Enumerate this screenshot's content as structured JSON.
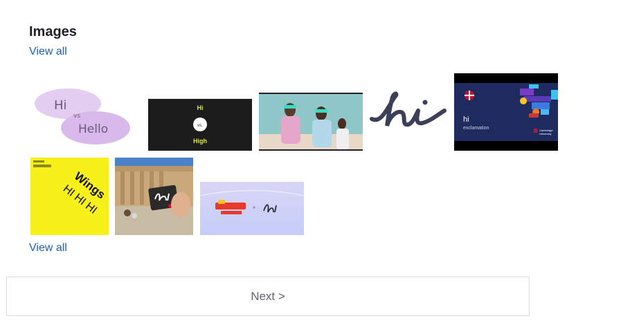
{
  "images_section": {
    "title": "Images",
    "view_all_top": "View all",
    "view_all_bottom": "View all"
  },
  "thumbnails": [
    {
      "name": "hi-vs-hello",
      "text": [
        "Hi",
        "vs",
        "Hello"
      ]
    },
    {
      "name": "hi-vs-high",
      "text": [
        "Hi",
        "vs.",
        "High"
      ]
    },
    {
      "name": "music-video-still",
      "text": []
    },
    {
      "name": "hi-handwritten",
      "text": [
        "hi"
      ]
    },
    {
      "name": "hi-exclamation-cambridge",
      "text": [
        "hi",
        "exclamation",
        "Cambridge",
        "University"
      ]
    },
    {
      "name": "wings-hi-hi-hi",
      "text": [
        "Wings",
        "HI",
        "HI",
        "HI"
      ]
    },
    {
      "name": "acropolis-card",
      "text": []
    },
    {
      "name": "carnival-hi",
      "text": [
        "hi"
      ]
    }
  ],
  "pagination": {
    "next_label": "Next >"
  }
}
